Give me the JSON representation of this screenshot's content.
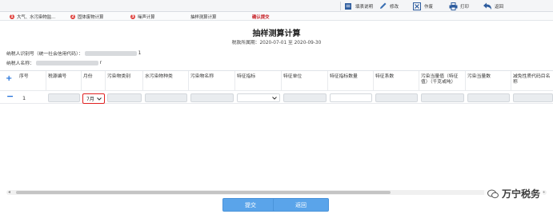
{
  "toolbar": {
    "buttons": [
      {
        "label": "填表说明",
        "icon": "doc-icon"
      },
      {
        "label": "修改",
        "icon": "pencil-icon"
      },
      {
        "label": "作废",
        "icon": "void-icon"
      },
      {
        "label": "打印",
        "icon": "printer-icon"
      },
      {
        "label": "返回",
        "icon": "back-arrow-icon"
      }
    ]
  },
  "steps": [
    {
      "label": "大气、水污染物监...",
      "num": "1"
    },
    {
      "label": "固体废物计算",
      "num": "2"
    },
    {
      "label": "噪声计算",
      "num": "3"
    },
    {
      "label": "抽样测算计算",
      "num": ""
    },
    {
      "label": "确认提交",
      "num": ""
    }
  ],
  "page": {
    "title": "抽样测算计算",
    "period": "税款所属期：2020-07-01 至 2020-09-30"
  },
  "taxpayer": {
    "id_label": "纳税人识别号（统一社会信用代码）：",
    "id_suffix": "1",
    "name_label": "纳税人名称：",
    "name_suffix": "r"
  },
  "table": {
    "headers": [
      "序号",
      "税源编号",
      "月份",
      "污染物类别",
      "水污染物种类",
      "污染物名称",
      "特征指标",
      "特征单位",
      "特征指标数量",
      "特征系数",
      "污染当量值（特征值）（千克或吨）",
      "污染当量数",
      "减免性质代码目名称"
    ],
    "rows": [
      {
        "index": "1",
        "month": "7月"
      }
    ]
  },
  "actions": {
    "submit": "提交",
    "back": "返回"
  },
  "watermark": "万宁税务"
}
